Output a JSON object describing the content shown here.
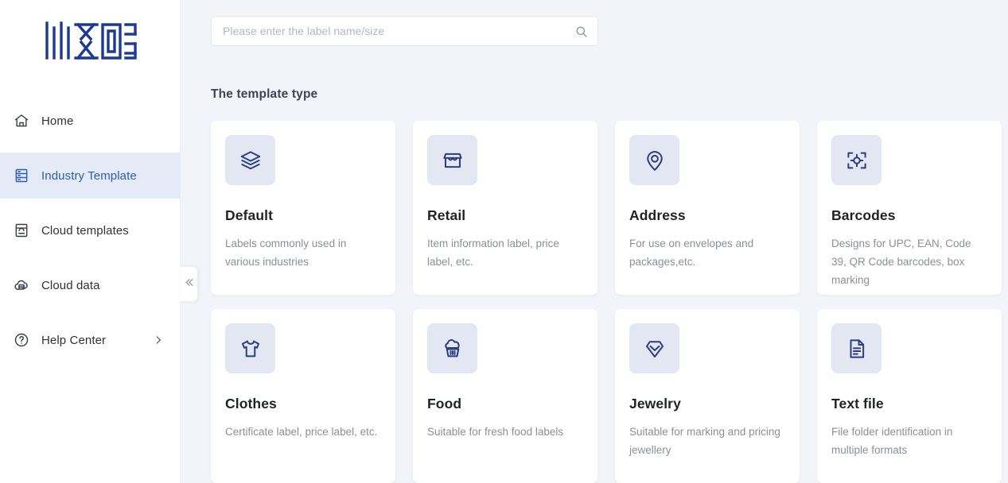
{
  "brand": {
    "logo_alt": "label-design-logo"
  },
  "sidebar": {
    "items": [
      {
        "id": "home",
        "label": "Home",
        "icon": "home-icon",
        "active": false,
        "has_arrow": false
      },
      {
        "id": "industry-template",
        "label": "Industry Template",
        "icon": "industry-template-icon",
        "active": true,
        "has_arrow": false
      },
      {
        "id": "cloud-templates",
        "label": "Cloud templates",
        "icon": "cloud-templates-icon",
        "active": false,
        "has_arrow": false
      },
      {
        "id": "cloud-data",
        "label": "Cloud data",
        "icon": "cloud-data-icon",
        "active": false,
        "has_arrow": false
      },
      {
        "id": "help-center",
        "label": "Help Center",
        "icon": "help-circle-icon",
        "active": false,
        "has_arrow": true
      }
    ],
    "collapse_handle_icon": "double-chevron-left-icon"
  },
  "search": {
    "placeholder": "Please enter the label name/size",
    "value": "",
    "icon": "search-icon"
  },
  "main": {
    "section_title": "The template type",
    "cards": [
      {
        "id": "default",
        "title": "Default",
        "desc": "Labels commonly used in various industries",
        "icon": "layers-icon"
      },
      {
        "id": "retail",
        "title": "Retail",
        "desc": "Item information label, price label, etc.",
        "icon": "store-icon"
      },
      {
        "id": "address",
        "title": "Address",
        "desc": "For use on envelopes and packages,etc.",
        "icon": "map-pin-icon"
      },
      {
        "id": "barcodes",
        "title": "Barcodes",
        "desc": "Designs for UPC, EAN, Code 39, QR Code barcodes, box marking",
        "icon": "barcode-scan-icon"
      },
      {
        "id": "clothes",
        "title": "Clothes",
        "desc": "Certificate label, price label, etc.",
        "icon": "tshirt-icon"
      },
      {
        "id": "food",
        "title": "Food",
        "desc": "Suitable for fresh food labels",
        "icon": "cupcake-icon"
      },
      {
        "id": "jewelry",
        "title": "Jewelry",
        "desc": "Suitable for marking and pricing jewellery",
        "icon": "diamond-icon"
      },
      {
        "id": "text-file",
        "title": "Text file",
        "desc": "File folder identification in multiple formats",
        "icon": "document-icon"
      }
    ]
  },
  "colors": {
    "page_background": "#f2f4f9",
    "sidebar_background": "#ffffff",
    "active_item_background": "#e4eaf6",
    "active_item_text": "#2f5db0",
    "card_background": "#ffffff",
    "icon_tile_background": "#e3e7f2",
    "icon_color": "#2c3e80",
    "logo_color": "#1b3a96",
    "title_color": "#1f2329",
    "description_color": "#8b8f99"
  }
}
